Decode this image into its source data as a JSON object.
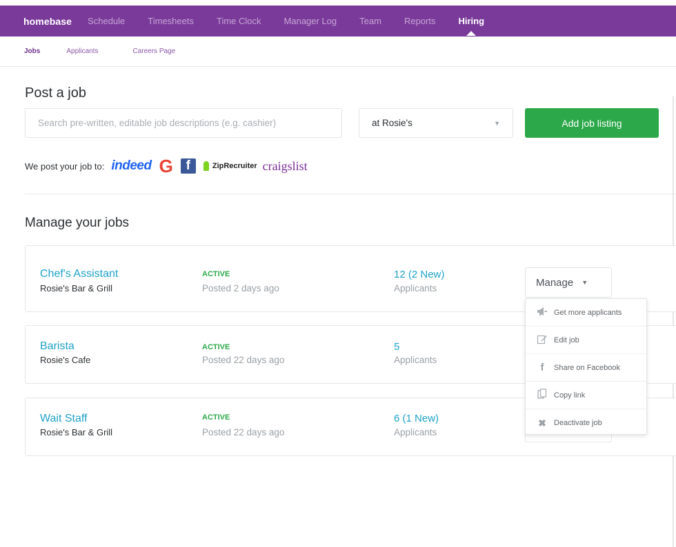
{
  "nav": {
    "brand": "homebase",
    "items": [
      "Schedule",
      "Timesheets",
      "Time Clock",
      "Manager Log",
      "Team",
      "Reports"
    ],
    "active": "Hiring"
  },
  "subnav": [
    "Jobs",
    "Applicants",
    "Careers Page"
  ],
  "post": {
    "title": "Post a job",
    "search_placeholder": "Search pre-written, editable job descriptions (e.g. cashier)",
    "location": "at Rosie's",
    "add_button": "Add job listing",
    "post_to_label": "We post your job to:",
    "logos": {
      "indeed": "indeed",
      "google": "G",
      "facebook": "f",
      "ziprecruiter": "ZipRecruiter",
      "craigslist": "craigslist"
    }
  },
  "manage": {
    "title": "Manage your jobs",
    "button_label": "Manage",
    "jobs": [
      {
        "title": "Chef's Assistant",
        "location": "Rosie's Bar & Grill",
        "status": "ACTIVE",
        "posted": "Posted 2 days ago",
        "applicants": "12 (2 New)",
        "applicants_label": "Applicants"
      },
      {
        "title": "Barista",
        "location": "Rosie's Cafe",
        "status": "ACTIVE",
        "posted": "Posted 22 days ago",
        "applicants": "5",
        "applicants_label": "Applicants"
      },
      {
        "title": "Wait Staff",
        "location": "Rosie's Bar & Grill",
        "status": "ACTIVE",
        "posted": "Posted 22 days ago",
        "applicants": "6 (1 New)",
        "applicants_label": "Applicants"
      }
    ],
    "menu": [
      {
        "label": "Get more applicants",
        "icon": "megaphone-icon"
      },
      {
        "label": "Edit job",
        "icon": "edit-icon"
      },
      {
        "label": "Share on Facebook",
        "icon": "facebook-icon"
      },
      {
        "label": "Copy link",
        "icon": "copy-icon"
      },
      {
        "label": "Deactivate job",
        "icon": "close-icon"
      }
    ]
  },
  "colors": {
    "nav_bg": "#7a3a9a",
    "accent_green": "#2ca84a",
    "link_blue": "#1ea2c9"
  }
}
